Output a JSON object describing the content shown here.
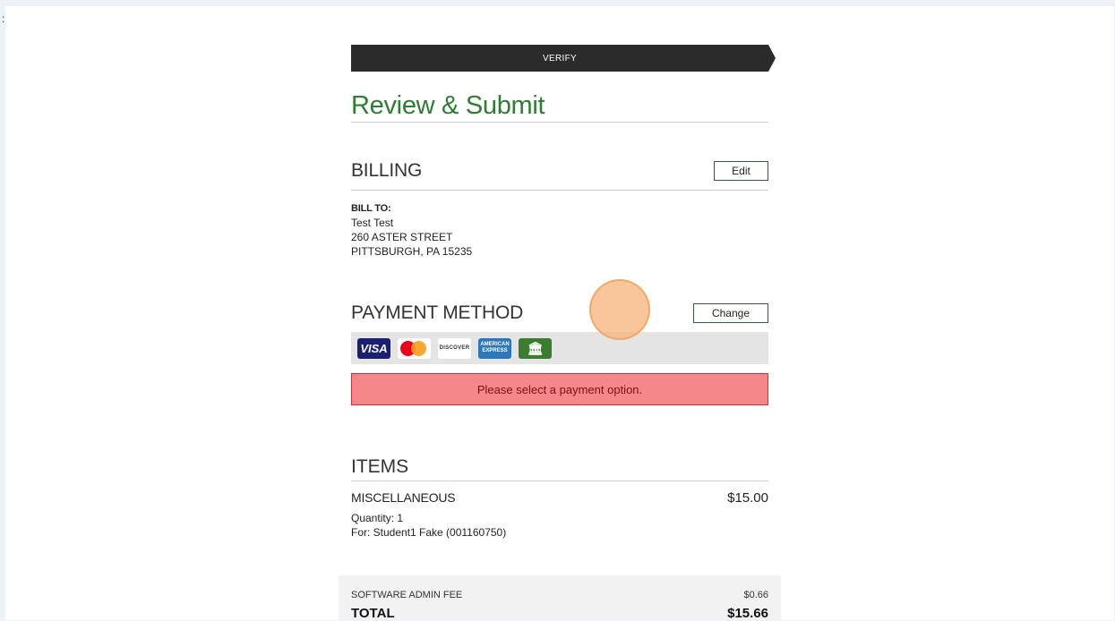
{
  "stepper": {
    "label": "VERIFY"
  },
  "page_title": "Review & Submit",
  "billing": {
    "title": "BILLING",
    "edit_label": "Edit",
    "bill_to_label": "BILL TO:",
    "name": "Test Test",
    "street": "260 ASTER STREET",
    "city_state_zip": "PITTSBURGH, PA 15235"
  },
  "payment": {
    "title": "PAYMENT METHOD",
    "change_label": "Change",
    "card_icons": [
      "visa-icon",
      "mastercard-icon",
      "discover-icon",
      "amex-icon",
      "bank-icon"
    ],
    "card_labels": {
      "visa": "VISA",
      "discover": "DISCOVER",
      "amex": "AMERICAN EXPRESS",
      "bank": "🏛"
    },
    "error_message": "Please select a payment option."
  },
  "items": {
    "title": "ITEMS",
    "list": [
      {
        "name": "MISCELLANEOUS",
        "price": "$15.00",
        "quantity": "Quantity: 1",
        "for": "For: Student1 Fake (001160750)"
      }
    ]
  },
  "totals": {
    "fee_label": "SOFTWARE ADMIN FEE",
    "fee_value": "$0.66",
    "total_label": "TOTAL",
    "total_value": "$15.66"
  },
  "colors": {
    "accent_green": "#2e7d32",
    "alert_bg": "#f5868a",
    "stepper_bg": "#2b2b2b"
  }
}
